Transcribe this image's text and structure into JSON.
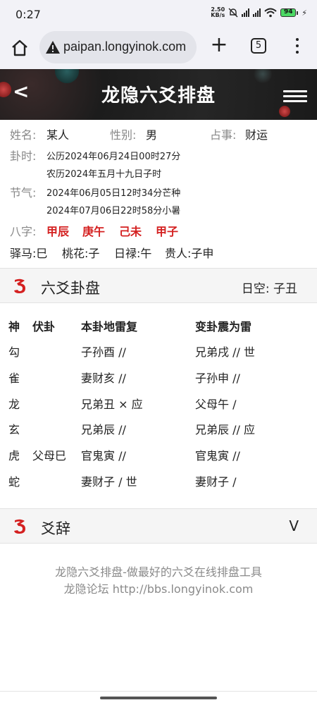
{
  "status_bar": {
    "time": "0:27",
    "speed_value": "2.50",
    "speed_unit": "KB/s",
    "battery": "94"
  },
  "browser": {
    "url": "paipan.longyinok.com",
    "tab_count": "5"
  },
  "header": {
    "back": "<",
    "title": "龙隐六爻排盘"
  },
  "info": {
    "name_label": "姓名:",
    "name_value": "某人",
    "gender_label": "性别:",
    "gender_value": "男",
    "matter_label": "占事:",
    "matter_value": "财运",
    "time_label": "卦时:",
    "time_solar": "公历2024年06月24日00时27分",
    "time_lunar": "农历2024年五月十九日子时",
    "jieqi_label": "节气:",
    "jieqi_1": "2024年06月05日12时34分芒种",
    "jieqi_2": "2024年07月06日22时58分小暑",
    "bazi_label": "八字:",
    "bazi": [
      "甲辰",
      "庚午",
      "己未",
      "甲子"
    ],
    "shensha": [
      "驿马:巳",
      "桃花:子",
      "日禄:午",
      "贵人:子申"
    ]
  },
  "gua_section": {
    "title": "六爻卦盘",
    "kong_label": "日空:",
    "kong_value": "子丑"
  },
  "gua_table": {
    "headers": [
      "神",
      "伏卦",
      "本卦地雷复",
      "变卦震为雷"
    ],
    "rows": [
      {
        "shen": "勾",
        "fu": "",
        "ben": "子孙酉 //",
        "bian": "兄弟戌 // 世"
      },
      {
        "shen": "雀",
        "fu": "",
        "ben": "妻财亥 //",
        "bian": "子孙申 //"
      },
      {
        "shen": "龙",
        "fu": "",
        "ben": "兄弟丑 × 应",
        "bian": "父母午 /"
      },
      {
        "shen": "玄",
        "fu": "",
        "ben": "兄弟辰 //",
        "bian": "兄弟辰 // 应"
      },
      {
        "shen": "虎",
        "fu": "父母巳",
        "ben": "官鬼寅 //",
        "bian": "官鬼寅 //"
      },
      {
        "shen": "蛇",
        "fu": "",
        "ben": "妻财子 / 世",
        "bian": "妻财子 /"
      }
    ]
  },
  "yaoci_section": {
    "title": "爻辞",
    "toggle": "V"
  },
  "footer": {
    "line1": "龙隐六爻排盘-做最好的六爻在线排盘工具",
    "line2": "龙隐论坛 http://bbs.longyinok.com"
  },
  "colors": {
    "accent_red": "#d42020",
    "header_bg": "#222222",
    "label_gray": "#888888"
  }
}
